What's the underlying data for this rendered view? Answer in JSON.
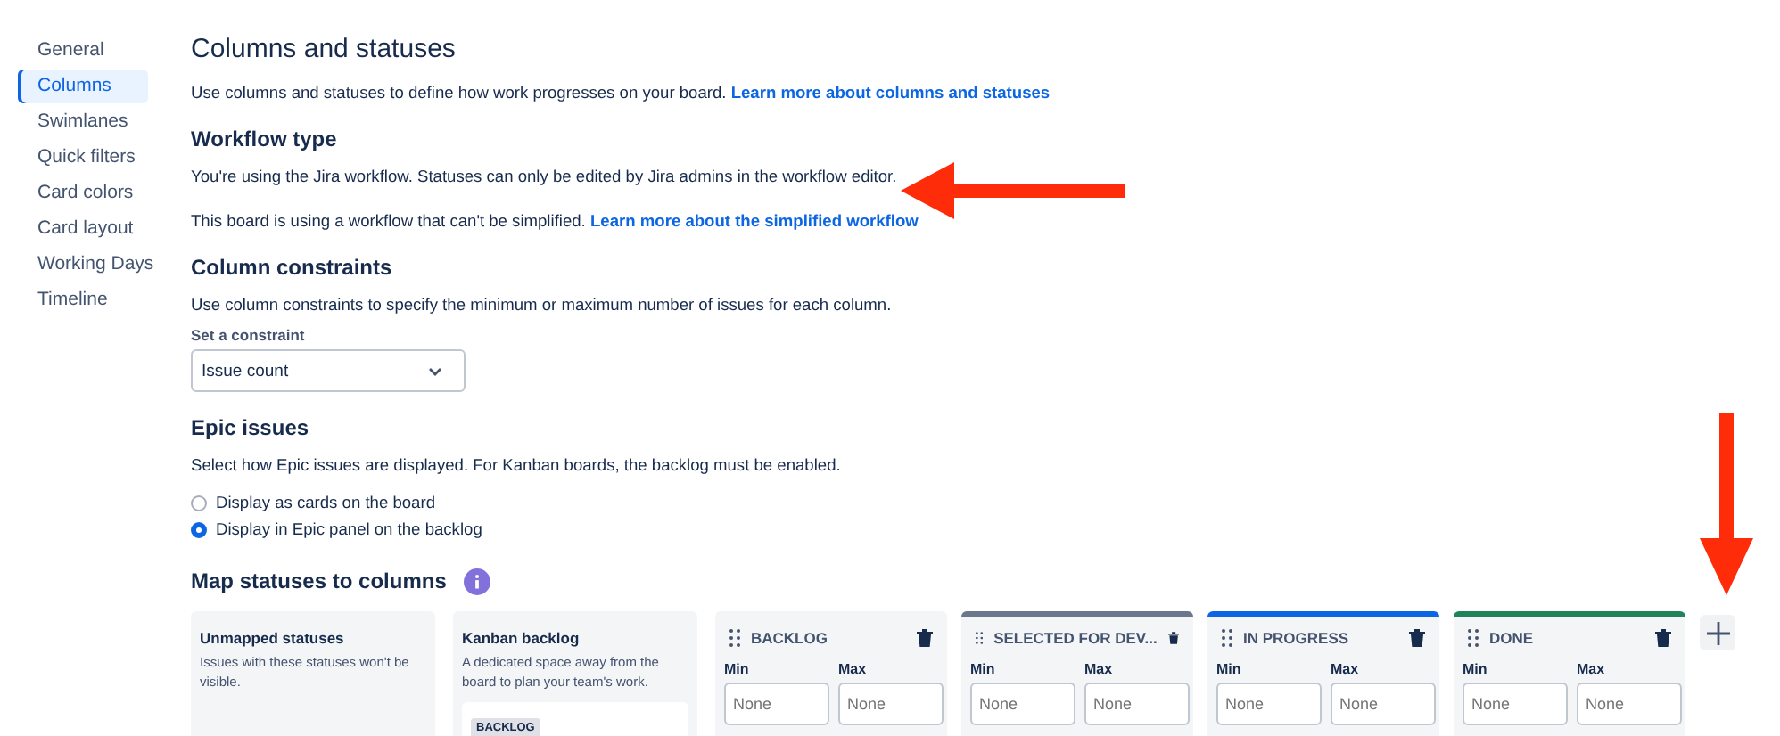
{
  "sidebar": {
    "items": [
      {
        "label": "General",
        "selected": false
      },
      {
        "label": "Columns",
        "selected": true
      },
      {
        "label": "Swimlanes",
        "selected": false
      },
      {
        "label": "Quick filters",
        "selected": false
      },
      {
        "label": "Card colors",
        "selected": false
      },
      {
        "label": "Card layout",
        "selected": false
      },
      {
        "label": "Working Days",
        "selected": false
      },
      {
        "label": "Timeline",
        "selected": false
      }
    ]
  },
  "title": "Columns and statuses",
  "intro": {
    "text": "Use columns and statuses to define how work progresses on your board.",
    "link": "Learn more about columns and statuses"
  },
  "workflow": {
    "heading": "Workflow type",
    "text": "You're using the Jira workflow. Statuses can only be edited by Jira admins in the workflow editor.",
    "note": "This board is using a workflow that can't be simplified.",
    "link": "Learn more about the simplified workflow"
  },
  "constraints": {
    "heading": "Column constraints",
    "text": "Use column constraints to specify the minimum or maximum number of issues for each column.",
    "label": "Set a constraint",
    "value": "Issue count"
  },
  "epics": {
    "heading": "Epic issues",
    "text": "Select how Epic issues are displayed. For Kanban boards, the backlog must be enabled.",
    "options": [
      {
        "label": "Display as cards on the board",
        "selected": false
      },
      {
        "label": "Display in Epic panel on the backlog",
        "selected": true
      }
    ]
  },
  "mapping": {
    "heading": "Map statuses to columns",
    "unmapped": {
      "title": "Unmapped statuses",
      "text": "Issues with these statuses won't be visible."
    },
    "backlog": {
      "title": "Kanban backlog",
      "text": "A dedicated space away from the board to plan your team's work.",
      "status": "BACKLOG"
    },
    "columns": [
      {
        "name": "BACKLOG",
        "min_label": "Min",
        "max_label": "Max",
        "min_placeholder": "None",
        "max_placeholder": "None"
      },
      {
        "name": "SELECTED FOR DEV...",
        "color": "#6b778c",
        "min_label": "Min",
        "max_label": "Max",
        "min_placeholder": "None",
        "max_placeholder": "None"
      },
      {
        "name": "IN PROGRESS",
        "color": "#0c66e4",
        "min_label": "Min",
        "max_label": "Max",
        "min_placeholder": "None",
        "max_placeholder": "None"
      },
      {
        "name": "DONE",
        "color": "#1f845a",
        "min_label": "Min",
        "max_label": "Max",
        "min_placeholder": "None",
        "max_placeholder": "None"
      }
    ]
  }
}
